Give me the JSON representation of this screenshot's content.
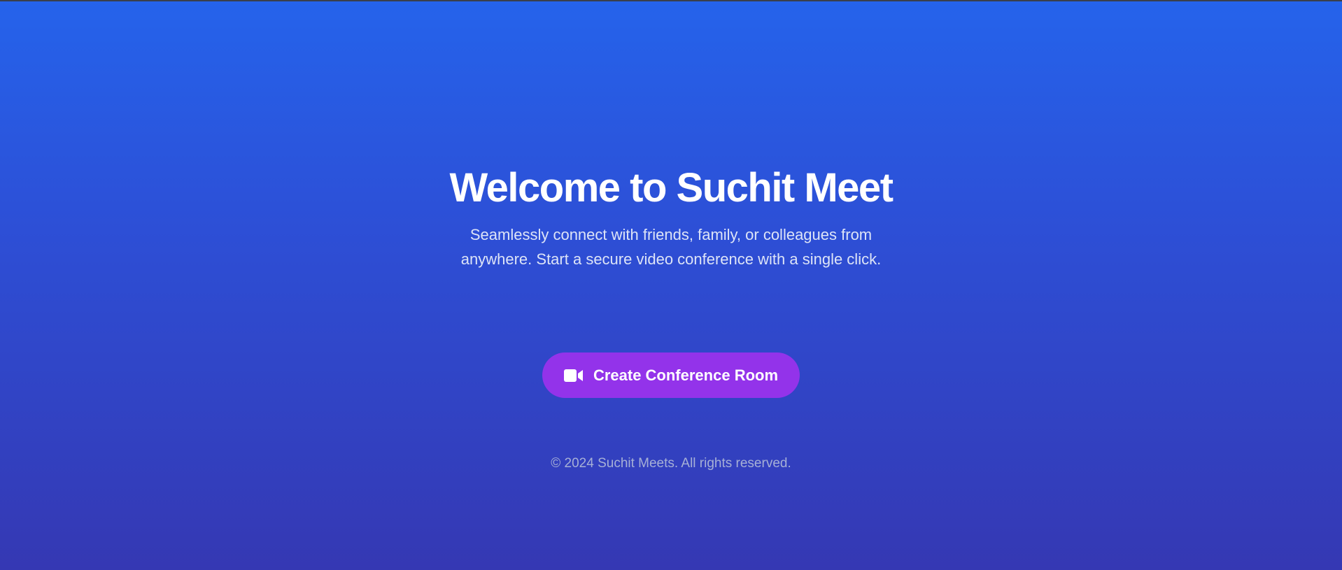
{
  "hero": {
    "title": "Welcome to Suchit Meet",
    "subtitle": "Seamlessly connect with friends, family, or colleagues from anywhere. Start a secure video conference with a single click."
  },
  "cta": {
    "label": "Create Conference Room",
    "icon": "video-camera-icon"
  },
  "footer": {
    "copyright": "© 2024 Suchit Meets. All rights reserved."
  },
  "colors": {
    "background_top": "#2563eb",
    "background_bottom": "#3538b3",
    "button": "#9333ea",
    "text": "#ffffff"
  }
}
